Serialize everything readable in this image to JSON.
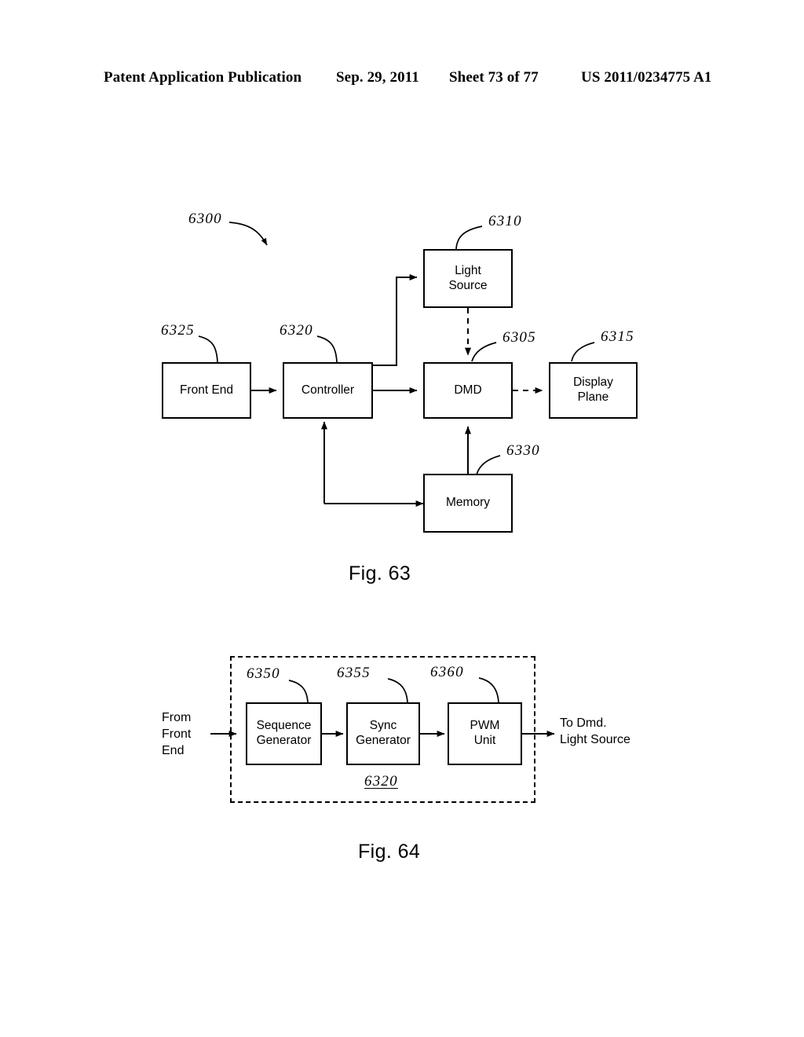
{
  "header": {
    "publication": "Patent Application Publication",
    "date": "Sep. 29, 2011",
    "sheet": "Sheet 73 of 77",
    "number": "US 2011/0234775 A1"
  },
  "figures": [
    {
      "caption": "Fig. 63",
      "system_ref": "6300",
      "boxes": [
        {
          "label": "Front End",
          "ref": "6325"
        },
        {
          "label": "Controller",
          "ref": "6320"
        },
        {
          "label": "Light\nSource",
          "ref": "6310"
        },
        {
          "label": "DMD",
          "ref": "6305"
        },
        {
          "label": "Display\nPlane",
          "ref": "6315"
        },
        {
          "label": "Memory",
          "ref": "6330"
        }
      ]
    },
    {
      "caption": "Fig. 64",
      "container_ref": "6320",
      "input_label": "From\nFront\nEnd",
      "output_label": "To Dmd.\nLight Source",
      "boxes": [
        {
          "label": "Sequence\nGenerator",
          "ref": "6350"
        },
        {
          "label": "Sync\nGenerator",
          "ref": "6355"
        },
        {
          "label": "PWM\nUnit",
          "ref": "6360"
        }
      ]
    }
  ],
  "colors": {
    "ink": "#000000",
    "paper": "#ffffff"
  }
}
